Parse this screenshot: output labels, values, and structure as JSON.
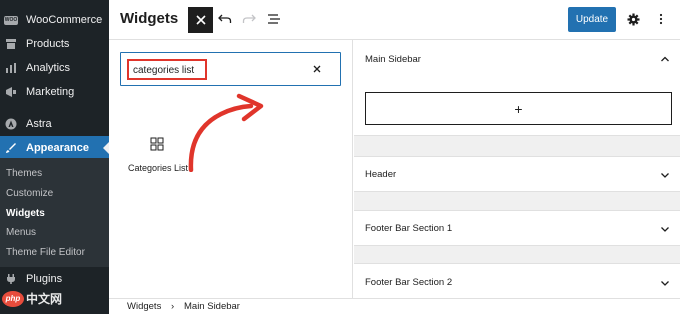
{
  "admin_menu": {
    "items": [
      {
        "label": "WooCommerce",
        "icon": "woo-icon"
      },
      {
        "label": "Products",
        "icon": "archive-icon"
      },
      {
        "label": "Analytics",
        "icon": "bar-chart-icon"
      },
      {
        "label": "Marketing",
        "icon": "megaphone-icon"
      },
      {
        "label": "Astra",
        "icon": "astra-icon"
      },
      {
        "label": "Appearance",
        "icon": "paintbrush-icon",
        "active": true
      },
      {
        "label": "Plugins",
        "icon": "plug-icon"
      }
    ],
    "woo_badge": "WOO",
    "submenu": [
      {
        "label": "Themes"
      },
      {
        "label": "Customize"
      },
      {
        "label": "Widgets",
        "current": true
      },
      {
        "label": "Menus"
      },
      {
        "label": "Theme File Editor"
      }
    ],
    "active_color": "#2271b1",
    "background": "#1d2327"
  },
  "header": {
    "title": "Widgets",
    "close_icon": "close-icon",
    "undo_icon": "undo-icon",
    "redo_icon": "redo-icon",
    "list_view_icon": "list-view-icon",
    "update_label": "Update",
    "settings_icon": "gear-icon",
    "more_icon": "more-vertical-icon"
  },
  "inserter": {
    "search_value": "categories list",
    "clear_icon": "close-icon",
    "annotation": "red-curved-arrow",
    "result": {
      "label": "Categories List",
      "icon": "grid-icon"
    }
  },
  "widget_areas": [
    {
      "title": "Main Sidebar",
      "expanded": true,
      "add_block_label": "+"
    },
    {
      "title": "Header",
      "expanded": false
    },
    {
      "title": "Footer Bar Section 1",
      "expanded": false
    },
    {
      "title": "Footer Bar Section 2",
      "expanded": false
    }
  ],
  "breadcrumb": {
    "root": "Widgets",
    "separator": "›",
    "current": "Main Sidebar"
  },
  "watermark": {
    "badge": "php",
    "text": "中文网"
  }
}
